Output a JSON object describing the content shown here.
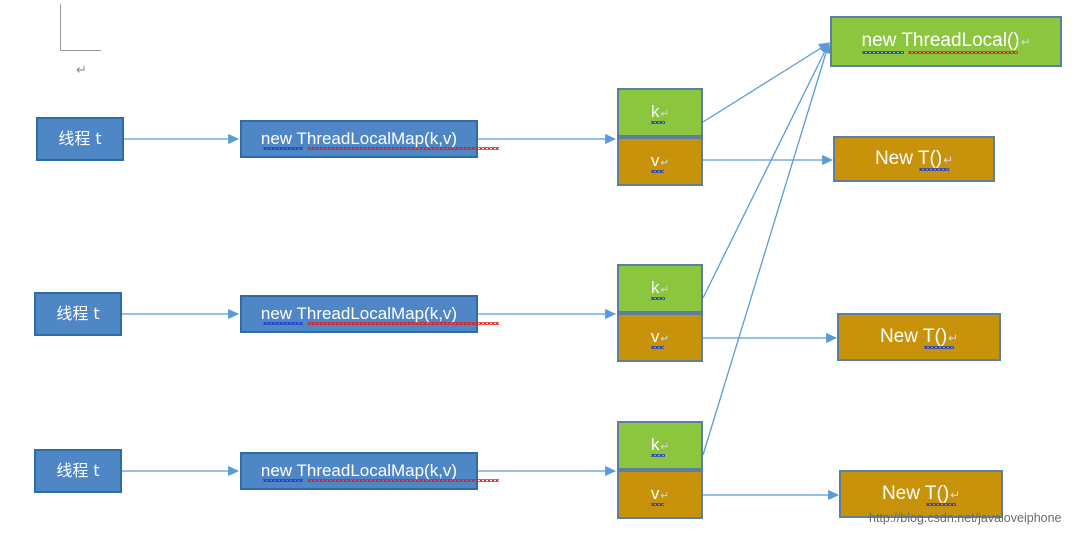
{
  "diagram": {
    "title": "ThreadLocal structure diagram",
    "colors": {
      "blue_fill": "#4f86c6",
      "blue_border": "#2e6ca8",
      "green_fill": "#8cc63e",
      "gold_fill": "#c8930b",
      "shape_border": "#5b7f9e",
      "connector": "#5b9bd5",
      "margin_mark": "#9a9a9a",
      "watermark": "#6b6b6b"
    },
    "margin_mark": {
      "pilcrow": "↵"
    },
    "rows": [
      {
        "thread_label": "线程 t",
        "map_label": "new ThreadLocalMap(k,v)",
        "key_label": "k",
        "value_label": "v",
        "target_label": "New T()"
      },
      {
        "thread_label": "线程 t",
        "map_label": "new ThreadLocalMap(k,v)",
        "key_label": "k",
        "value_label": "v",
        "target_label": "New T()"
      },
      {
        "thread_label": "线程 t",
        "map_label": "new ThreadLocalMap(k,v)",
        "key_label": "k",
        "value_label": "v",
        "target_label": "New T()"
      }
    ],
    "shared_threadlocal": {
      "label": "new ThreadLocal()"
    },
    "watermark": "http://blog.csdn.net/javaloveiphone"
  }
}
